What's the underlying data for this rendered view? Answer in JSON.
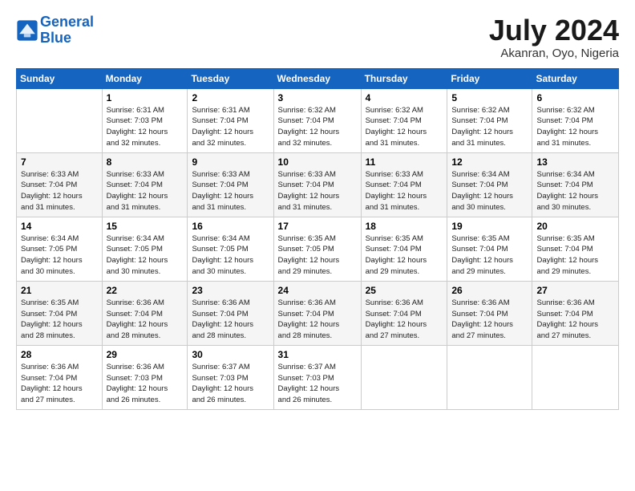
{
  "logo": {
    "line1": "General",
    "line2": "Blue"
  },
  "title": "July 2024",
  "location": "Akanran, Oyo, Nigeria",
  "days_header": [
    "Sunday",
    "Monday",
    "Tuesday",
    "Wednesday",
    "Thursday",
    "Friday",
    "Saturday"
  ],
  "weeks": [
    [
      {
        "num": "",
        "info": ""
      },
      {
        "num": "1",
        "info": "Sunrise: 6:31 AM\nSunset: 7:03 PM\nDaylight: 12 hours\nand 32 minutes."
      },
      {
        "num": "2",
        "info": "Sunrise: 6:31 AM\nSunset: 7:04 PM\nDaylight: 12 hours\nand 32 minutes."
      },
      {
        "num": "3",
        "info": "Sunrise: 6:32 AM\nSunset: 7:04 PM\nDaylight: 12 hours\nand 32 minutes."
      },
      {
        "num": "4",
        "info": "Sunrise: 6:32 AM\nSunset: 7:04 PM\nDaylight: 12 hours\nand 31 minutes."
      },
      {
        "num": "5",
        "info": "Sunrise: 6:32 AM\nSunset: 7:04 PM\nDaylight: 12 hours\nand 31 minutes."
      },
      {
        "num": "6",
        "info": "Sunrise: 6:32 AM\nSunset: 7:04 PM\nDaylight: 12 hours\nand 31 minutes."
      }
    ],
    [
      {
        "num": "7",
        "info": "Sunrise: 6:33 AM\nSunset: 7:04 PM\nDaylight: 12 hours\nand 31 minutes."
      },
      {
        "num": "8",
        "info": "Sunrise: 6:33 AM\nSunset: 7:04 PM\nDaylight: 12 hours\nand 31 minutes."
      },
      {
        "num": "9",
        "info": "Sunrise: 6:33 AM\nSunset: 7:04 PM\nDaylight: 12 hours\nand 31 minutes."
      },
      {
        "num": "10",
        "info": "Sunrise: 6:33 AM\nSunset: 7:04 PM\nDaylight: 12 hours\nand 31 minutes."
      },
      {
        "num": "11",
        "info": "Sunrise: 6:33 AM\nSunset: 7:04 PM\nDaylight: 12 hours\nand 31 minutes."
      },
      {
        "num": "12",
        "info": "Sunrise: 6:34 AM\nSunset: 7:04 PM\nDaylight: 12 hours\nand 30 minutes."
      },
      {
        "num": "13",
        "info": "Sunrise: 6:34 AM\nSunset: 7:04 PM\nDaylight: 12 hours\nand 30 minutes."
      }
    ],
    [
      {
        "num": "14",
        "info": "Sunrise: 6:34 AM\nSunset: 7:05 PM\nDaylight: 12 hours\nand 30 minutes."
      },
      {
        "num": "15",
        "info": "Sunrise: 6:34 AM\nSunset: 7:05 PM\nDaylight: 12 hours\nand 30 minutes."
      },
      {
        "num": "16",
        "info": "Sunrise: 6:34 AM\nSunset: 7:05 PM\nDaylight: 12 hours\nand 30 minutes."
      },
      {
        "num": "17",
        "info": "Sunrise: 6:35 AM\nSunset: 7:05 PM\nDaylight: 12 hours\nand 29 minutes."
      },
      {
        "num": "18",
        "info": "Sunrise: 6:35 AM\nSunset: 7:04 PM\nDaylight: 12 hours\nand 29 minutes."
      },
      {
        "num": "19",
        "info": "Sunrise: 6:35 AM\nSunset: 7:04 PM\nDaylight: 12 hours\nand 29 minutes."
      },
      {
        "num": "20",
        "info": "Sunrise: 6:35 AM\nSunset: 7:04 PM\nDaylight: 12 hours\nand 29 minutes."
      }
    ],
    [
      {
        "num": "21",
        "info": "Sunrise: 6:35 AM\nSunset: 7:04 PM\nDaylight: 12 hours\nand 28 minutes."
      },
      {
        "num": "22",
        "info": "Sunrise: 6:36 AM\nSunset: 7:04 PM\nDaylight: 12 hours\nand 28 minutes."
      },
      {
        "num": "23",
        "info": "Sunrise: 6:36 AM\nSunset: 7:04 PM\nDaylight: 12 hours\nand 28 minutes."
      },
      {
        "num": "24",
        "info": "Sunrise: 6:36 AM\nSunset: 7:04 PM\nDaylight: 12 hours\nand 28 minutes."
      },
      {
        "num": "25",
        "info": "Sunrise: 6:36 AM\nSunset: 7:04 PM\nDaylight: 12 hours\nand 27 minutes."
      },
      {
        "num": "26",
        "info": "Sunrise: 6:36 AM\nSunset: 7:04 PM\nDaylight: 12 hours\nand 27 minutes."
      },
      {
        "num": "27",
        "info": "Sunrise: 6:36 AM\nSunset: 7:04 PM\nDaylight: 12 hours\nand 27 minutes."
      }
    ],
    [
      {
        "num": "28",
        "info": "Sunrise: 6:36 AM\nSunset: 7:04 PM\nDaylight: 12 hours\nand 27 minutes."
      },
      {
        "num": "29",
        "info": "Sunrise: 6:36 AM\nSunset: 7:03 PM\nDaylight: 12 hours\nand 26 minutes."
      },
      {
        "num": "30",
        "info": "Sunrise: 6:37 AM\nSunset: 7:03 PM\nDaylight: 12 hours\nand 26 minutes."
      },
      {
        "num": "31",
        "info": "Sunrise: 6:37 AM\nSunset: 7:03 PM\nDaylight: 12 hours\nand 26 minutes."
      },
      {
        "num": "",
        "info": ""
      },
      {
        "num": "",
        "info": ""
      },
      {
        "num": "",
        "info": ""
      }
    ]
  ]
}
